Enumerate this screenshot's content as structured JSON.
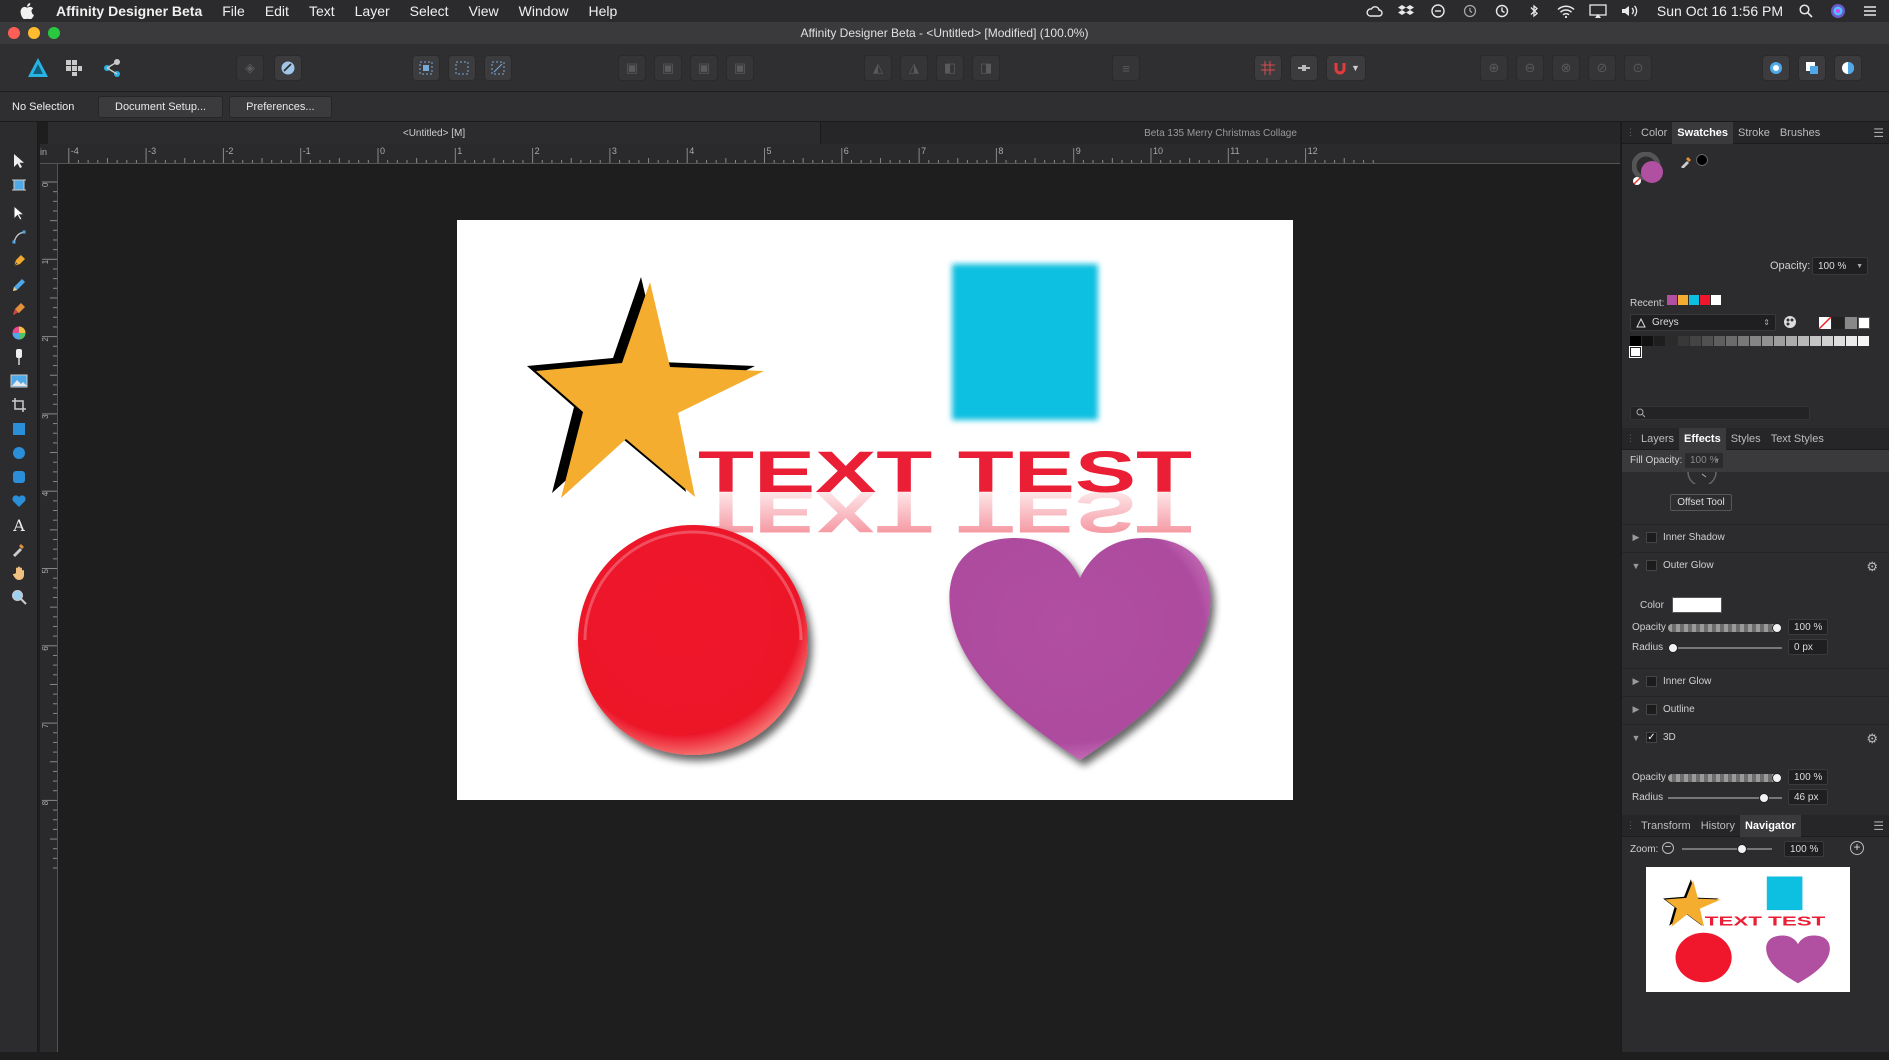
{
  "menubar": {
    "app_name": "Affinity Designer Beta",
    "items": [
      "File",
      "Edit",
      "Text",
      "Layer",
      "Select",
      "View",
      "Window",
      "Help"
    ],
    "status_icons": [
      "creative-cloud-icon",
      "dropbox-icon",
      "sync-icon",
      "history-icon",
      "time-machine-icon",
      "bluetooth-icon",
      "wifi-icon",
      "airplay-icon",
      "volume-icon"
    ],
    "clock": "Sun Oct 16  1:56 PM"
  },
  "window": {
    "title": "Affinity Designer Beta - <Untitled> [Modified] (100.0%)"
  },
  "context": {
    "selection_label": "No Selection",
    "document_setup_label": "Document Setup...",
    "preferences_label": "Preferences..."
  },
  "doctabs": {
    "active": "<Untitled> [M]",
    "inactive": "Beta 135 Merry Christmas Collage"
  },
  "ruler": {
    "unit": "in",
    "h_labels": [
      "-4",
      "-3",
      "-2",
      "-1",
      "0",
      "1",
      "2",
      "3",
      "4",
      "5",
      "6",
      "7",
      "8",
      "9",
      "10",
      "11",
      "12"
    ],
    "v_labels": [
      "0",
      "1",
      "2",
      "3",
      "4",
      "5",
      "6",
      "7",
      "8"
    ]
  },
  "artwork": {
    "text": "TEXT TEST",
    "colors": {
      "star": "#f4ad2f",
      "square": "#0dbfe0",
      "circle": "#f0162c",
      "heart": "#b14fa1",
      "text": "#ea1f35"
    }
  },
  "colorpanel": {
    "tabs": [
      "Color",
      "Swatches",
      "Stroke",
      "Brushes"
    ],
    "active_tab": "Swatches",
    "opacity_label": "Opacity:",
    "opacity_value": "100 %",
    "recent_label": "Recent:",
    "recent_colors": [
      "#b14fa1",
      "#f4ad2f",
      "#0dbfe0",
      "#f0162c",
      "#ffffff"
    ],
    "palette_name": "Greys",
    "greys": [
      "#000000",
      "#111111",
      "#1e1e1e",
      "#2b2b2b",
      "#383838",
      "#444444",
      "#515151",
      "#5e5e5e",
      "#6b6b6b",
      "#787878",
      "#858585",
      "#919191",
      "#9e9e9e",
      "#ababab",
      "#b8b8b8",
      "#c5c5c5",
      "#d2d2d2",
      "#dedede",
      "#ebebeb",
      "#f5f5f5",
      "#ffffff"
    ]
  },
  "effectspanel": {
    "tabs": [
      "Layers",
      "Effects",
      "Styles",
      "Text Styles"
    ],
    "active_tab": "Effects",
    "fill_opacity_label": "Fill Opacity:",
    "fill_opacity_value": "100 %",
    "offset_tool_label": "Offset Tool",
    "inner_shadow": "Inner Shadow",
    "outer_glow": {
      "label": "Outer Glow",
      "color_label": "Color",
      "color": "#ffffff",
      "opacity_label": "Opacity",
      "opacity_value": "100 %",
      "opacity_fraction": 1.0,
      "radius_label": "Radius",
      "radius_value": "0 px",
      "radius_fraction": 0.0
    },
    "inner_glow": "Inner Glow",
    "outline": "Outline",
    "threed": {
      "label": "3D",
      "checked": true,
      "opacity_label": "Opacity",
      "opacity_value": "100 %",
      "opacity_fraction": 1.0,
      "radius_label": "Radius",
      "radius_value": "46 px"
    }
  },
  "navigator": {
    "tabs": [
      "Transform",
      "History",
      "Navigator"
    ],
    "active_tab": "Navigator",
    "zoom_label": "Zoom:",
    "zoom_value": "100 %",
    "preview_text": "TEXT TEST"
  }
}
